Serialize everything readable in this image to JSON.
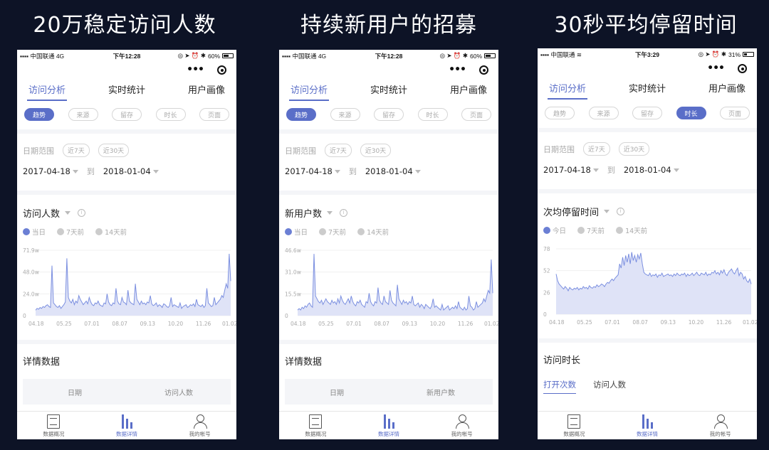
{
  "panels": [
    {
      "headline": "20万稳定访问人数",
      "status": {
        "carrier": "中国联通",
        "network": "4G",
        "time": "下午12:28",
        "battery": "60%",
        "battery_level": 0.6
      },
      "tabs": [
        "访问分析",
        "实时统计",
        "用户画像"
      ],
      "chips": [
        "趋势",
        "来源",
        "留存",
        "时长",
        "页面"
      ],
      "active_chip": 0,
      "range": {
        "label": "日期范围",
        "quick": [
          "近7天",
          "近30天"
        ],
        "start": "2017-04-18",
        "to": "到",
        "end": "2018-01-04"
      },
      "metric": "访问人数",
      "legend": [
        "当日",
        "7天前",
        "14天前"
      ],
      "chart_data": {
        "type": "area",
        "yticks": [
          "71.9w",
          "48.0w",
          "24.0w",
          "0"
        ],
        "ymax": 71.9,
        "xticks": [
          "04.18",
          "05.25",
          "07.01",
          "08.07",
          "09.13",
          "10.20",
          "11.26",
          "01.02"
        ],
        "values": [
          6,
          8,
          7,
          9,
          8,
          10,
          9,
          11,
          12,
          10,
          9,
          55,
          14,
          12,
          10,
          9,
          11,
          8,
          10,
          12,
          15,
          63,
          20,
          16,
          14,
          18,
          12,
          16,
          14,
          22,
          18,
          15,
          12,
          14,
          16,
          13,
          20,
          15,
          12,
          11,
          14,
          13,
          16,
          12,
          11,
          10,
          14,
          13,
          24,
          15,
          12,
          11,
          14,
          13,
          30,
          16,
          13,
          12,
          20,
          15,
          14,
          12,
          28,
          16,
          14,
          13,
          12,
          35,
          18,
          15,
          12,
          16,
          13,
          14,
          12,
          15,
          14,
          22,
          13,
          11,
          12,
          14,
          10,
          12,
          11,
          9,
          13,
          12,
          10,
          9,
          11,
          20,
          10,
          12,
          11,
          10,
          9,
          14,
          8,
          10,
          11,
          12,
          9,
          10,
          12,
          11,
          13,
          10,
          18,
          12,
          11,
          10,
          12,
          9,
          11,
          30,
          14,
          12,
          10,
          11,
          20,
          12,
          14,
          16,
          18,
          22,
          20,
          28,
          35,
          30,
          68,
          38
        ]
      },
      "details": {
        "title": "详情数据",
        "columns": [
          "日期",
          "访问人数"
        ]
      },
      "bottom": [
        "数据概况",
        "数据详情",
        "我的帐号"
      ]
    },
    {
      "headline": "持续新用户的招募",
      "status": {
        "carrier": "中国联通",
        "network": "4G",
        "time": "下午12:28",
        "battery": "60%",
        "battery_level": 0.6
      },
      "tabs": [
        "访问分析",
        "实时统计",
        "用户画像"
      ],
      "chips": [
        "趋势",
        "来源",
        "留存",
        "时长",
        "页面"
      ],
      "active_chip": 0,
      "range": {
        "label": "日期范围",
        "quick": [
          "近7天",
          "近30天"
        ],
        "start": "2017-04-18",
        "to": "到",
        "end": "2018-01-04"
      },
      "metric": "新用户数",
      "legend": [
        "当日",
        "7天前",
        "14天前"
      ],
      "chart_data": {
        "type": "area",
        "yticks": [
          "46.6w",
          "31.0w",
          "15.5w",
          "0"
        ],
        "ymax": 46.6,
        "xticks": [
          "04.18",
          "05.25",
          "07.01",
          "08.07",
          "09.13",
          "10.20",
          "11.26",
          "01.02"
        ],
        "values": [
          4,
          5,
          4,
          6,
          5,
          7,
          6,
          8,
          9,
          7,
          6,
          44,
          14,
          12,
          10,
          9,
          11,
          8,
          10,
          12,
          10,
          9,
          8,
          11,
          9,
          10,
          8,
          12,
          9,
          14,
          11,
          9,
          8,
          10,
          12,
          9,
          14,
          10,
          8,
          7,
          10,
          9,
          11,
          8,
          7,
          6,
          10,
          9,
          16,
          10,
          8,
          7,
          10,
          9,
          20,
          11,
          9,
          8,
          14,
          10,
          9,
          8,
          18,
          11,
          9,
          8,
          7,
          22,
          12,
          10,
          8,
          11,
          9,
          10,
          8,
          10,
          9,
          14,
          8,
          7,
          8,
          9,
          6,
          8,
          7,
          5,
          8,
          7,
          6,
          5,
          7,
          12,
          6,
          7,
          6,
          5,
          4,
          8,
          4,
          5,
          6,
          7,
          4,
          5,
          6,
          5,
          7,
          5,
          10,
          6,
          5,
          4,
          6,
          4,
          5,
          14,
          7,
          6,
          4,
          5,
          10,
          6,
          7,
          8,
          9,
          12,
          10,
          14,
          18,
          16,
          40,
          16
        ]
      },
      "details": {
        "title": "详情数据",
        "columns": [
          "日期",
          "新用户数"
        ]
      },
      "bottom": [
        "数据概况",
        "数据详情",
        "我的帐号"
      ]
    },
    {
      "headline": "30秒平均停留时间",
      "status": {
        "carrier": "中国联通",
        "network": "wifi",
        "time": "下午3:29",
        "battery": "31%",
        "battery_level": 0.31
      },
      "tabs": [
        "访问分析",
        "实时统计",
        "用户画像"
      ],
      "chips": [
        "趋势",
        "来源",
        "留存",
        "时长",
        "页面"
      ],
      "active_chip": 3,
      "range": {
        "label": "日期范围",
        "quick": [
          "近7天",
          "近30天"
        ],
        "start": "2017-04-18",
        "to": "到",
        "end": "2018-01-04"
      },
      "metric": "次均停留时间",
      "legend": [
        "今日",
        "7天前",
        "14天前"
      ],
      "chart_data": {
        "type": "area",
        "yticks": [
          "78",
          "52",
          "26",
          "0"
        ],
        "ymax": 78,
        "xticks": [
          "04.18",
          "05.25",
          "07.01",
          "08.07",
          "09.13",
          "10.20",
          "11.26",
          "01.02"
        ],
        "values": [
          48,
          40,
          36,
          34,
          32,
          30,
          33,
          31,
          28,
          32,
          30,
          29,
          31,
          30,
          32,
          29,
          31,
          30,
          33,
          31,
          32,
          30,
          34,
          32,
          31,
          33,
          32,
          35,
          33,
          34,
          36,
          35,
          33,
          36,
          38,
          37,
          40,
          42,
          40,
          43,
          45,
          47,
          60,
          55,
          68,
          58,
          70,
          62,
          72,
          60,
          74,
          64,
          70,
          62,
          71,
          66,
          73,
          60,
          50,
          48,
          47,
          46,
          49,
          45,
          47,
          46,
          48,
          44,
          47,
          46,
          49,
          45,
          46,
          47,
          48,
          46,
          47,
          45,
          48,
          46,
          49,
          47,
          46,
          48,
          47,
          49,
          45,
          48,
          46,
          47,
          49,
          46,
          48,
          50,
          47,
          46,
          49,
          48,
          47,
          50,
          46,
          48,
          47,
          50,
          49,
          52,
          48,
          50,
          47,
          52,
          49,
          53,
          48,
          46,
          50,
          52,
          54,
          50,
          48,
          52,
          55,
          46,
          50,
          48,
          42,
          45,
          40,
          38,
          42,
          36
        ]
      },
      "details": {
        "title": "访问时长",
        "subtabs": [
          "打开次数",
          "访问人数"
        ]
      },
      "bottom": [
        "数据概况",
        "数据详情",
        "我的帐号"
      ]
    }
  ],
  "colors": {
    "accent": "#5a6ec8",
    "line": "#7b8fe0",
    "fill": "#dfe3f7",
    "background": "#0d1326"
  }
}
